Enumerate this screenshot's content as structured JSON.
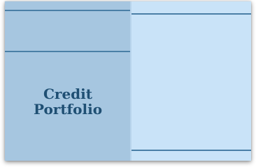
{
  "panel": {
    "title_line1": "Credit",
    "title_line2": "Portfolio"
  },
  "colors": {
    "left_panel": "#a6c6e0",
    "right_panel": "#c9e3f8",
    "rule": "#4a7fa6",
    "title": "#1f4f73"
  }
}
